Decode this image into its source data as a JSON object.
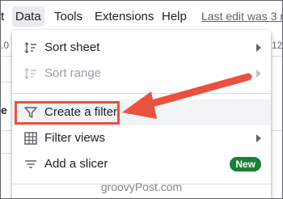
{
  "menubar": {
    "items": [
      "t",
      "Data",
      "Tools",
      "Extensions",
      "Help"
    ],
    "last_edit": "Last edit was 3 m"
  },
  "toolbar_fragments": [
    ".0",
    "12",
    "▼"
  ],
  "row_header_fragment": "e",
  "menu": {
    "items": [
      {
        "label": "Sort sheet",
        "icon": "sort-icon",
        "submenu": true,
        "disabled": false
      },
      {
        "label": "Sort range",
        "icon": "sort-icon",
        "submenu": true,
        "disabled": true
      },
      {
        "label": "Create a filter",
        "icon": "filter-icon",
        "submenu": false,
        "disabled": false,
        "highlighted": true
      },
      {
        "label": "Filter views",
        "icon": "grid-icon",
        "submenu": true,
        "disabled": false
      },
      {
        "label": "Add a slicer",
        "icon": "slicer-icon",
        "submenu": false,
        "disabled": false,
        "badge": "New"
      }
    ]
  },
  "colors": {
    "accent_arrow": "#e8523f",
    "badge": "#188038",
    "highlight": "#f1f3f4"
  },
  "watermark": "groovyPost.com"
}
